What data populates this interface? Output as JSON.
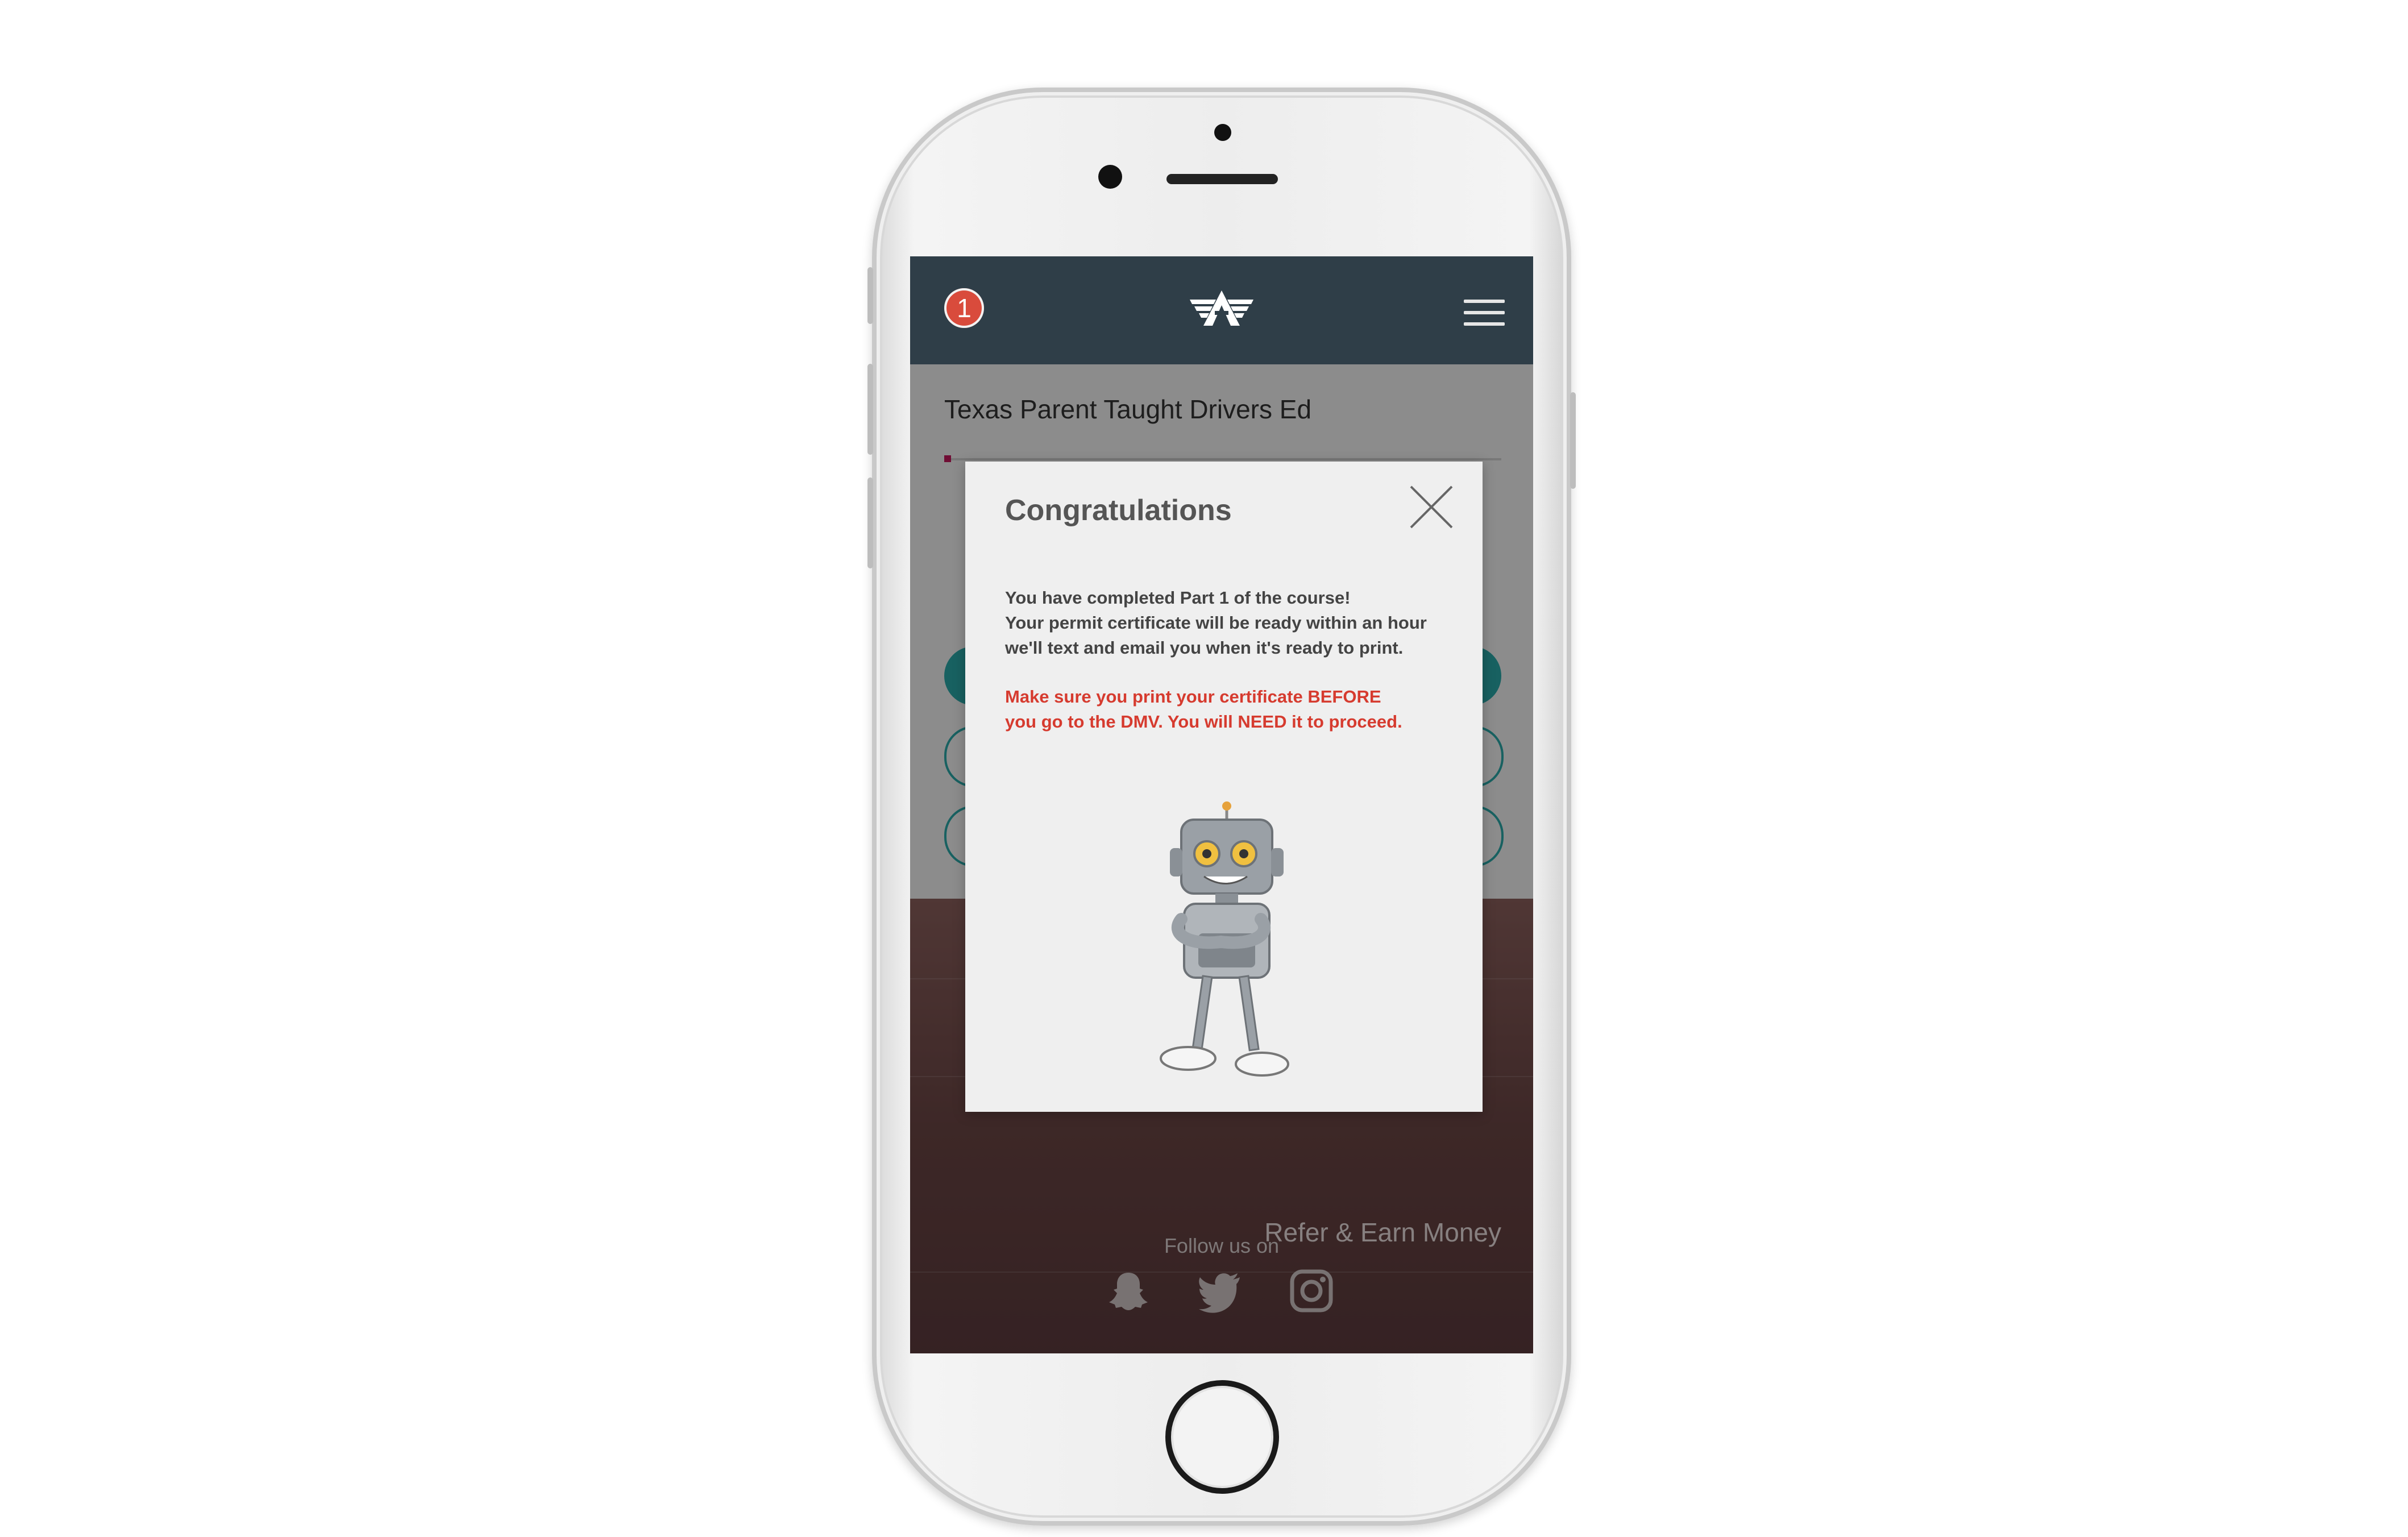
{
  "app": {
    "notification_count": "1",
    "course_title": "Texas Parent Taught Drivers Ed",
    "progress_fraction": 0.01
  },
  "footer": {
    "links": [
      "Refer & Earn Money"
    ],
    "follow_label": "Follow us on",
    "social": [
      "snapchat-icon",
      "twitter-icon",
      "instagram-icon"
    ]
  },
  "modal": {
    "title": "Congratulations",
    "message_lines": [
      "You have completed Part 1 of the course!",
      "Your permit certificate will be ready within an hour",
      "we'll text and email  you when it's ready to print."
    ],
    "warning_lines": [
      "Make sure you print your certificate BEFORE",
      "you go to the DMV. You will NEED it to proceed."
    ]
  },
  "colors": {
    "appbar": "#2f3e48",
    "accent_teal": "#2aa7a7",
    "warning_red": "#d63b2f",
    "badge_red": "#d94b3c"
  }
}
